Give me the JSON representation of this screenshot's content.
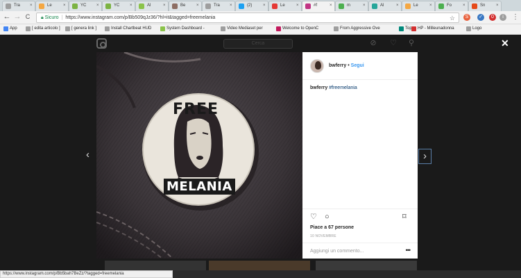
{
  "browser": {
    "tabs": [
      {
        "label": "Tra",
        "active": false,
        "color": "#9e9e9e"
      },
      {
        "label": "Le",
        "active": false,
        "color": "#f4a742"
      },
      {
        "label": "YC",
        "active": false,
        "color": "#7cb342"
      },
      {
        "label": "YC",
        "active": false,
        "color": "#7cb342"
      },
      {
        "label": "Al",
        "active": false,
        "color": "#8bc34a"
      },
      {
        "label": "Be",
        "active": false,
        "color": "#8d6e63"
      },
      {
        "label": "Tra",
        "active": false,
        "color": "#9e9e9e"
      },
      {
        "label": "(2)",
        "active": false,
        "color": "#1da1f2"
      },
      {
        "label": "Le",
        "active": false,
        "color": "#e53935"
      },
      {
        "label": "#f",
        "active": true,
        "color": "#c13584"
      },
      {
        "label": "m",
        "active": false,
        "color": "#4caf50"
      },
      {
        "label": "Al",
        "active": false,
        "color": "#26a69a"
      },
      {
        "label": "Le",
        "active": false,
        "color": "#f4a742"
      },
      {
        "label": "Fo",
        "active": false,
        "color": "#4caf50"
      },
      {
        "label": "Sn",
        "active": false,
        "color": "#e64a19"
      }
    ],
    "tab_close": "×",
    "back_icon": "←",
    "forward_icon": "→",
    "reload_icon": "C",
    "secure_label": "Sicuro",
    "url": "https://www.instagram.com/p/Bb509qJz36/?hl=it&tagged=freemelania",
    "star_icon": "☆",
    "menu_icon": "⋮",
    "extensions": [
      {
        "label": "S",
        "color": "#e8603c"
      },
      {
        "label": "✓",
        "color": "#3a78c3"
      },
      {
        "label": "0",
        "color": "#d32f2f"
      },
      {
        "label": "i",
        "color": "#9e9e9e"
      }
    ]
  },
  "bookmarks": [
    {
      "label": "App",
      "color": "#4285f4"
    },
    {
      "label": "[ edita articolo ]",
      "color": "#9e9e9e"
    },
    {
      "label": "[ genera link ]",
      "color": "#9e9e9e"
    },
    {
      "label": "Install Chartbeat HUD",
      "color": "#9e9e9e"
    },
    {
      "label": "System Dashboard -",
      "color": "#8bc34a"
    },
    {
      "label": "Video Mediaset per",
      "color": "#9e9e9e"
    },
    {
      "label": "Welcome to OpenC",
      "color": "#c2185b"
    },
    {
      "label": "From Aggressive Ove",
      "color": "#9e9e9e"
    },
    {
      "label": "Top",
      "color": "#00897b"
    },
    {
      "label": "HP - Milleunadonna",
      "color": "#d32f2f"
    },
    {
      "label": "Logo",
      "color": "#9e9e9e"
    }
  ],
  "instagram": {
    "search_placeholder": "Cerca",
    "close_label": "✕",
    "prev_arrow": "‹",
    "next_arrow": "›",
    "header_icons": [
      "⊘",
      "♡",
      "⚲"
    ],
    "post": {
      "username": "bwferry",
      "separator": "•",
      "follow_label": "Segui",
      "caption_user": "bwferry",
      "caption_tag": "#freemelania",
      "photo_text_top": "FREE",
      "photo_text_bottom": "MELANIA",
      "likes": "Piace a 67 persone",
      "date": "10 NOVEMBRE",
      "comment_placeholder": "Aggiungi un commento...",
      "more_icon": "•••",
      "like_icon": "♡",
      "comment_icon": "○",
      "save_icon": "⌑"
    }
  },
  "status_url": "https://www.instagram.com/p/Bb5bah7BeZz/?tagged=freemelania"
}
